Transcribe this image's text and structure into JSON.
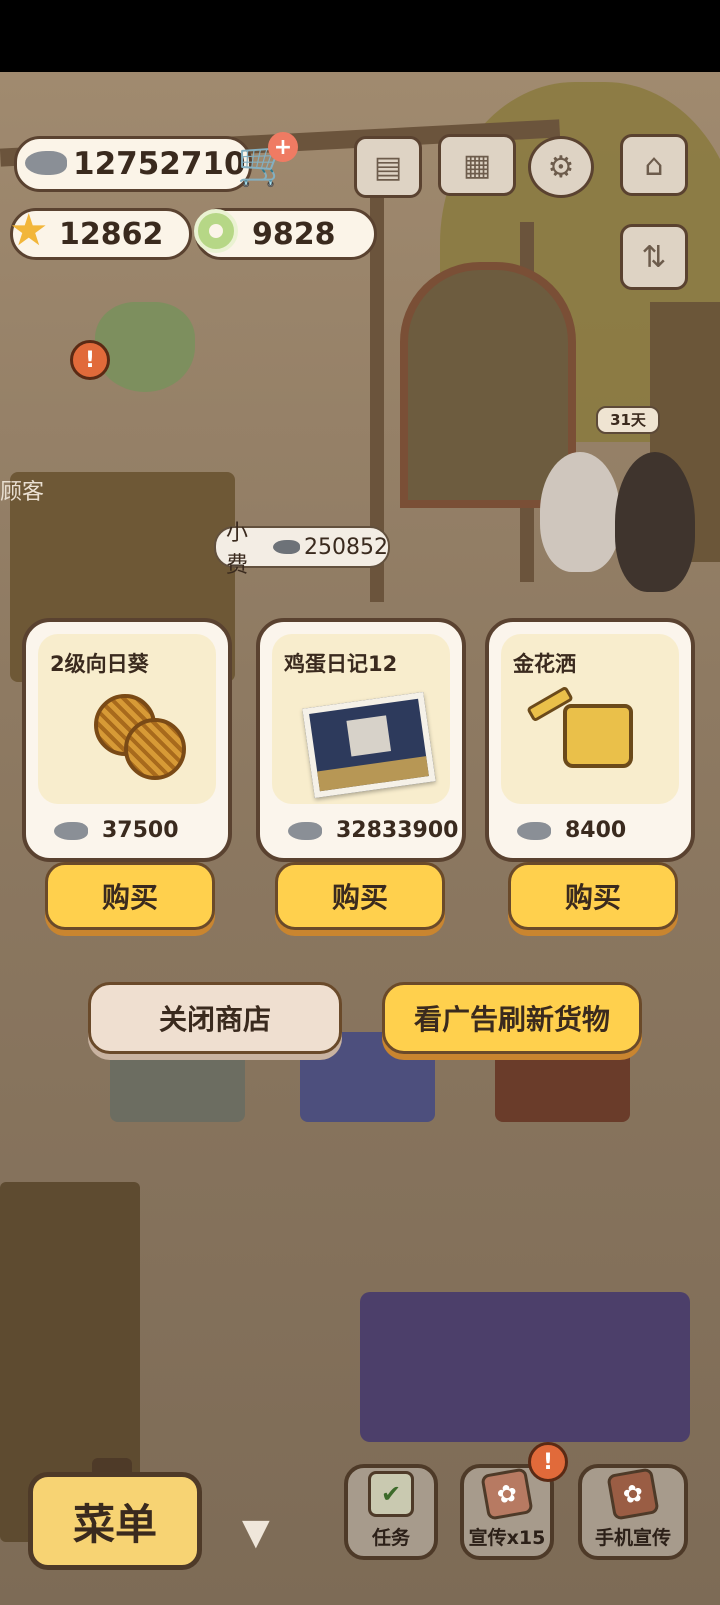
{
  "currency": {
    "fish": "12752710",
    "stars": "12862",
    "gems": "9828"
  },
  "scene": {
    "day_label": "31天",
    "customer_label": "顾客",
    "tip_label": "小费",
    "tip_amount": "250852"
  },
  "shop": {
    "items": [
      {
        "name": "2级向日葵",
        "price": "37500",
        "buy_label": "购买",
        "icon": "sunflower-icon"
      },
      {
        "name": "鸡蛋日记12",
        "price": "32833900",
        "buy_label": "购买",
        "icon": "photo-icon"
      },
      {
        "name": "金花洒",
        "price": "8400",
        "buy_label": "购买",
        "icon": "watering-can-icon"
      }
    ],
    "close_label": "关闭商店",
    "refresh_label": "看广告刷新货物"
  },
  "bottom_bar": {
    "menu_label": "菜单",
    "task_label": "任务",
    "promo_label": "宣传x15",
    "phone_promo_label": "手机宣传"
  },
  "colors": {
    "accent_yellow": "#ffd04d",
    "card_bg": "#fbf5ec",
    "outline": "#5a4230",
    "alert": "#e16a3a"
  }
}
